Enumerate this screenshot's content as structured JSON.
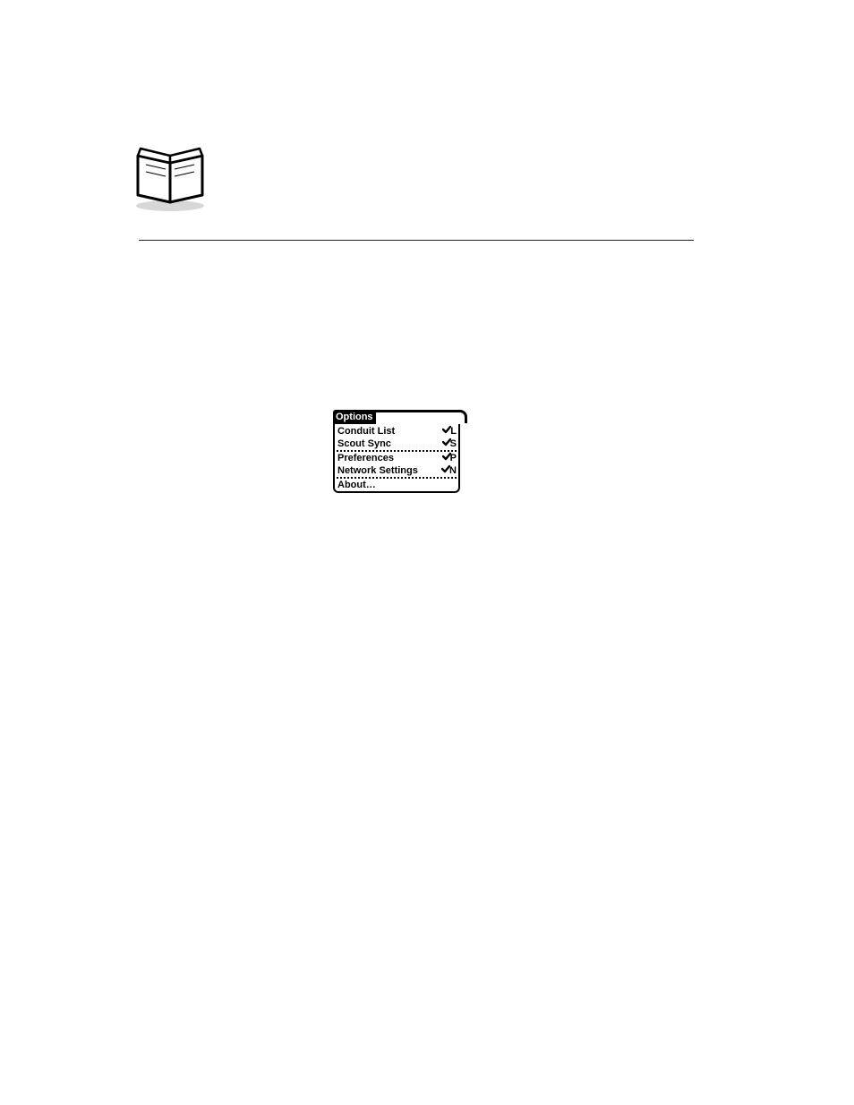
{
  "menu": {
    "title": "Options",
    "groups": [
      [
        {
          "label": "Conduit List",
          "shortcut": "L"
        },
        {
          "label": "Scout Sync",
          "shortcut": "S"
        }
      ],
      [
        {
          "label": "Preferences",
          "shortcut": "P"
        },
        {
          "label": "Network Settings",
          "shortcut": "N"
        }
      ],
      [
        {
          "label": "About…",
          "shortcut": ""
        }
      ]
    ]
  }
}
